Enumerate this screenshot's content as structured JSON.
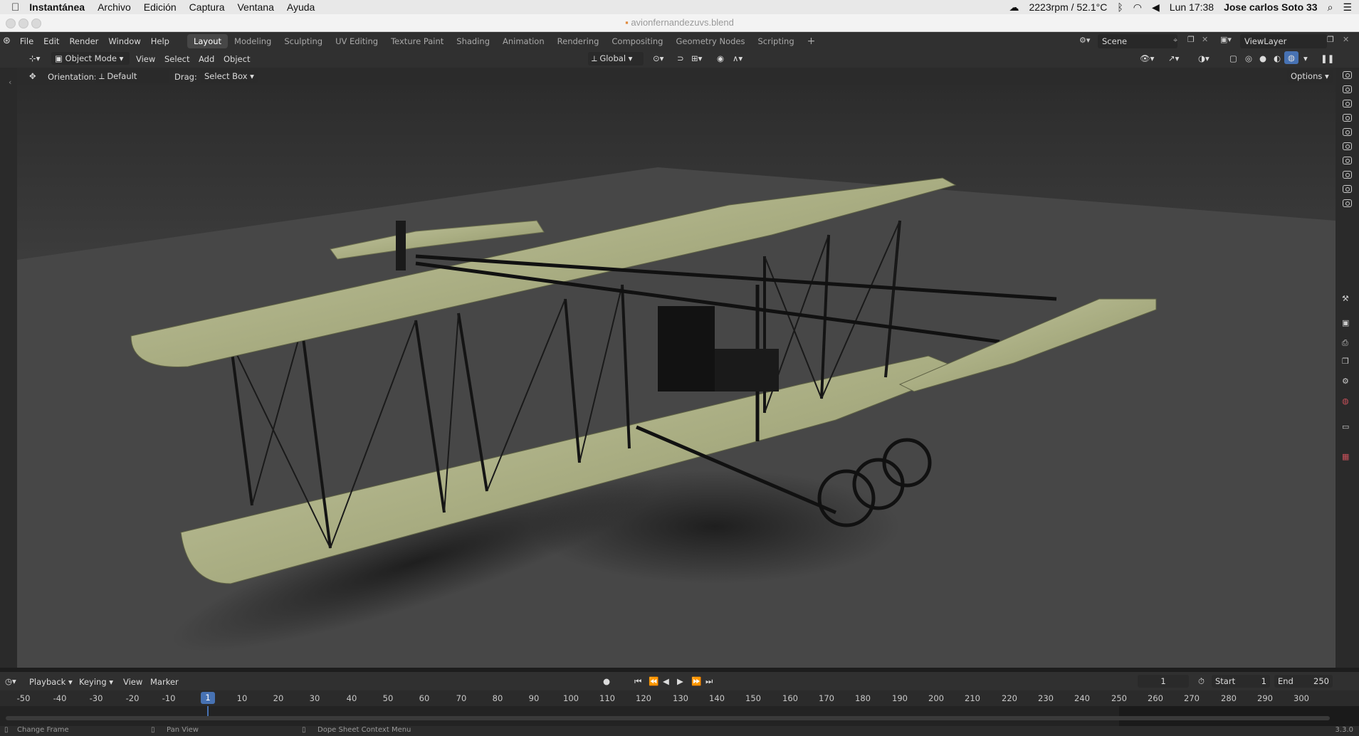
{
  "mac_menubar": {
    "app_name": "Instantánea",
    "menus": [
      "Archivo",
      "Edición",
      "Captura",
      "Ventana",
      "Ayuda"
    ],
    "fan_status": "2223rpm / 52.1°C",
    "clock": "Lun 17:38",
    "user": "Jose carlos Soto 33"
  },
  "window": {
    "title": "avionfernandezuvs.blend"
  },
  "topbar": {
    "menus": [
      "File",
      "Edit",
      "Render",
      "Window",
      "Help"
    ],
    "workspaces": [
      "Layout",
      "Modeling",
      "Sculpting",
      "UV Editing",
      "Texture Paint",
      "Shading",
      "Animation",
      "Rendering",
      "Compositing",
      "Geometry Nodes",
      "Scripting"
    ],
    "active_workspace": "Layout",
    "add_tab": "+",
    "scene": "Scene",
    "view_layer": "ViewLayer"
  },
  "viewport_header": {
    "mode": "Object Mode",
    "menus": [
      "View",
      "Select",
      "Add",
      "Object"
    ],
    "transform_orientation": "Global"
  },
  "tool_settings": {
    "orientation_label": "Orientation:",
    "orientation_value": "Default",
    "drag_label": "Drag:",
    "drag_value": "Select Box",
    "options": "Options"
  },
  "timeline": {
    "menus": [
      "Playback",
      "Keying",
      "View",
      "Marker"
    ],
    "current_frame": "1",
    "start_label": "Start",
    "start_value": "1",
    "end_label": "End",
    "end_value": "250",
    "ruler_ticks": [
      "-50",
      "-40",
      "-30",
      "-20",
      "-10",
      "1",
      "10",
      "20",
      "30",
      "40",
      "50",
      "60",
      "70",
      "80",
      "90",
      "100",
      "110",
      "120",
      "130",
      "140",
      "150",
      "160",
      "170",
      "180",
      "190",
      "200",
      "210",
      "220",
      "230",
      "240",
      "250",
      "260",
      "270",
      "280",
      "290",
      "300"
    ],
    "playhead": "1"
  },
  "status_bar": {
    "left": "Change Frame",
    "middle": "Pan View",
    "right": "Dope Sheet Context Menu",
    "version": "3.3.0"
  },
  "colors": {
    "wing_fabric": "#a9ad82",
    "frame_black": "#151515",
    "viewport_bg": "#3f3f3f",
    "accent_blue": "#4772b3"
  }
}
